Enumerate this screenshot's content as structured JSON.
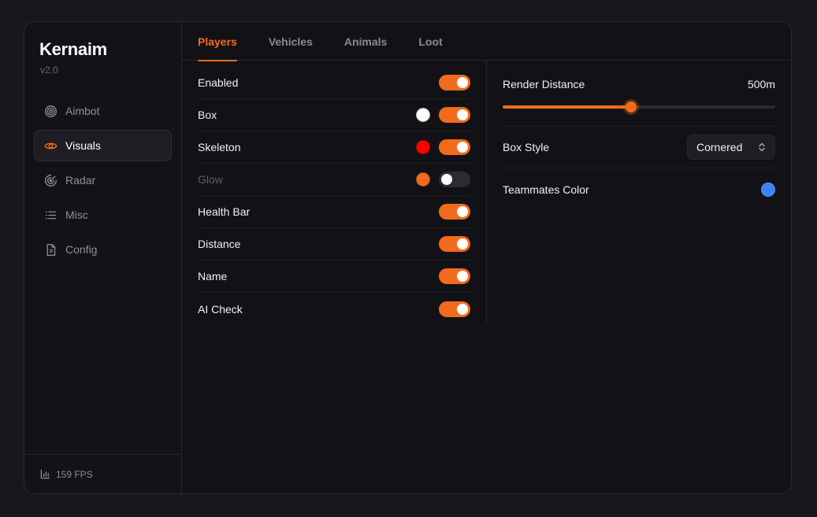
{
  "app": {
    "name": "Kernaim",
    "version": "v2.0"
  },
  "sidebar": {
    "items": [
      {
        "label": "Aimbot",
        "icon": "target-icon"
      },
      {
        "label": "Visuals",
        "icon": "eye-icon",
        "active": true
      },
      {
        "label": "Radar",
        "icon": "radar-icon"
      },
      {
        "label": "Misc",
        "icon": "list-icon"
      },
      {
        "label": "Config",
        "icon": "file-icon"
      }
    ],
    "fps": "159 FPS"
  },
  "tabs": [
    {
      "label": "Players",
      "active": true
    },
    {
      "label": "Vehicles"
    },
    {
      "label": "Animals"
    },
    {
      "label": "Loot"
    }
  ],
  "settings": [
    {
      "label": "Enabled",
      "on": true
    },
    {
      "label": "Box",
      "on": true,
      "color": "#ffffff"
    },
    {
      "label": "Skeleton",
      "on": true,
      "color": "#ff0000"
    },
    {
      "label": "Glow",
      "on": false,
      "color": "#f26b1c",
      "disabled": true
    },
    {
      "label": "Health Bar",
      "on": true
    },
    {
      "label": "Distance",
      "on": true
    },
    {
      "label": "Name",
      "on": true
    },
    {
      "label": "AI Check",
      "on": true
    }
  ],
  "render_distance": {
    "label": "Render Distance",
    "value": "500m",
    "fraction": 0.47
  },
  "box_style": {
    "label": "Box Style",
    "value": "Cornered"
  },
  "teammates_color": {
    "label": "Teammates Color",
    "color": "#3b82f6"
  },
  "colors": {
    "accent": "#f26b1c",
    "background": "#121216"
  }
}
